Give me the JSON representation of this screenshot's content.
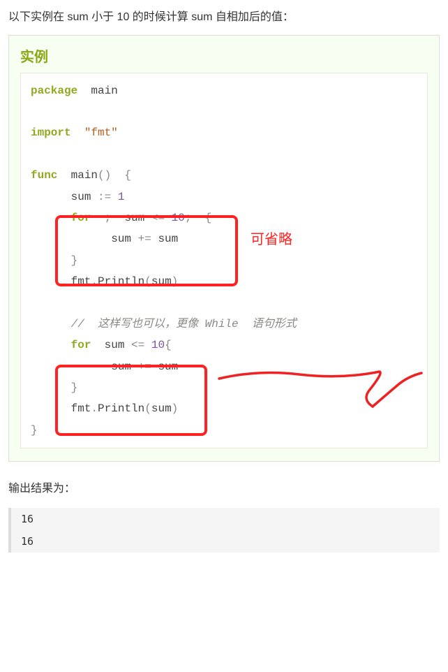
{
  "intro": "以下实例在 sum 小于 10 的时候计算 sum 自相加后的值：",
  "example_title": "实例",
  "code": {
    "tokens": [
      [
        [
          "kw",
          "package"
        ],
        [
          "",
          "  "
        ],
        [
          "ident",
          "main"
        ]
      ],
      [],
      [
        [
          "kw",
          "import"
        ],
        [
          "",
          "  "
        ],
        [
          "str",
          "\"fmt\""
        ]
      ],
      [],
      [
        [
          "kw",
          "func"
        ],
        [
          "",
          "  "
        ],
        [
          "func-name",
          "main"
        ],
        [
          "punct",
          "()"
        ],
        [
          "",
          "  "
        ],
        [
          "punct",
          "{"
        ]
      ],
      [
        [
          "",
          "      "
        ],
        [
          "ident",
          "sum "
        ],
        [
          "punct",
          ":="
        ],
        [
          "",
          " "
        ],
        [
          "num",
          "1"
        ]
      ],
      [
        [
          "",
          "      "
        ],
        [
          "kw",
          "for"
        ],
        [
          "",
          "  "
        ],
        [
          "punct",
          ";"
        ],
        [
          "",
          "  "
        ],
        [
          "ident",
          "sum "
        ],
        [
          "punct",
          "<="
        ],
        [
          "",
          " "
        ],
        [
          "num",
          "10"
        ],
        [
          "punct",
          ";"
        ],
        [
          "",
          "  "
        ],
        [
          "punct",
          "{"
        ]
      ],
      [
        [
          "",
          "            "
        ],
        [
          "ident",
          "sum "
        ],
        [
          "punct",
          "+="
        ],
        [
          "",
          " "
        ],
        [
          "ident",
          "sum"
        ]
      ],
      [
        [
          "",
          "      "
        ],
        [
          "punct",
          "}"
        ]
      ],
      [
        [
          "",
          "      "
        ],
        [
          "ident",
          "fmt"
        ],
        [
          "punct",
          "."
        ],
        [
          "func-name",
          "Println"
        ],
        [
          "punct",
          "("
        ],
        [
          "ident",
          "sum"
        ],
        [
          "punct",
          ")"
        ]
      ],
      [],
      [
        [
          "",
          "      "
        ],
        [
          "comment",
          "//  这样写也可以，更像 While  语句形式"
        ]
      ],
      [
        [
          "",
          "      "
        ],
        [
          "kw",
          "for"
        ],
        [
          "",
          "  "
        ],
        [
          "ident",
          "sum "
        ],
        [
          "punct",
          "<="
        ],
        [
          "",
          " "
        ],
        [
          "num",
          "10"
        ],
        [
          "punct",
          "{"
        ]
      ],
      [
        [
          "",
          "            "
        ],
        [
          "ident",
          "sum "
        ],
        [
          "punct",
          "+="
        ],
        [
          "",
          " "
        ],
        [
          "ident",
          "sum"
        ]
      ],
      [
        [
          "",
          "      "
        ],
        [
          "punct",
          "}"
        ]
      ],
      [
        [
          "",
          "      "
        ],
        [
          "ident",
          "fmt"
        ],
        [
          "punct",
          "."
        ],
        [
          "func-name",
          "Println"
        ],
        [
          "punct",
          "("
        ],
        [
          "ident",
          "sum"
        ],
        [
          "punct",
          ")"
        ]
      ],
      [
        [
          "punct",
          "}"
        ]
      ]
    ]
  },
  "annotation1": "可省略",
  "output_label": "输出结果为：",
  "output": [
    "16",
    "16"
  ]
}
